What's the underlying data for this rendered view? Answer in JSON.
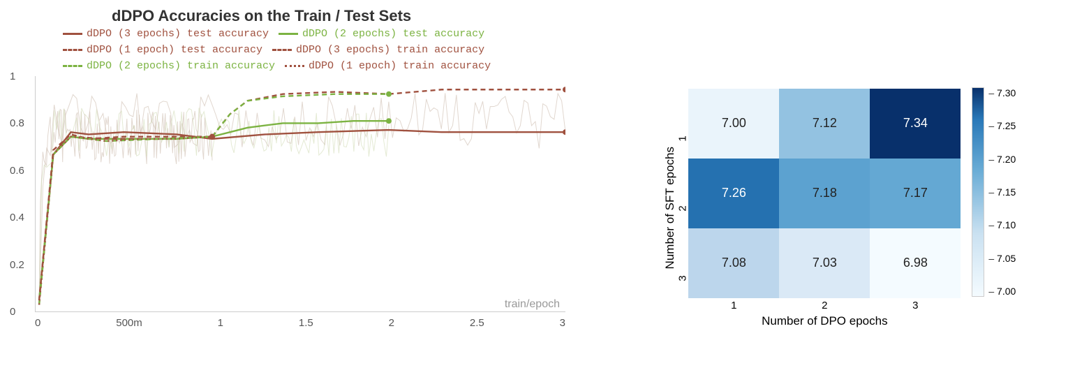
{
  "chart_data": [
    {
      "type": "line",
      "title": "dDPO Accuracies on the Train / Test Sets",
      "xlabel": "train/epoch",
      "x_ticks": [
        "0",
        "500m",
        "1",
        "1.5",
        "2",
        "2.5",
        "3"
      ],
      "y_ticks": [
        "0",
        "0.2",
        "0.4",
        "0.6",
        "0.8",
        "1"
      ],
      "xlim": [
        0,
        3
      ],
      "ylim": [
        0,
        1.05
      ],
      "series": [
        {
          "name": "dDPO (3 epochs) test accuracy",
          "color": "#a0513f",
          "style": "solid",
          "x": [
            0.02,
            0.1,
            0.2,
            0.3,
            0.5,
            0.8,
            1.0,
            1.3,
            1.6,
            2.0,
            2.3,
            2.6,
            3.0
          ],
          "y": [
            0.05,
            0.7,
            0.8,
            0.79,
            0.8,
            0.79,
            0.77,
            0.79,
            0.8,
            0.81,
            0.8,
            0.8,
            0.8
          ]
        },
        {
          "name": "dDPO (2 epochs) test accuracy",
          "color": "#7cb342",
          "style": "solid",
          "x": [
            0.02,
            0.1,
            0.2,
            0.3,
            0.5,
            0.8,
            1.0,
            1.2,
            1.4,
            1.6,
            1.8,
            2.0
          ],
          "y": [
            0.05,
            0.7,
            0.78,
            0.77,
            0.77,
            0.77,
            0.78,
            0.82,
            0.84,
            0.84,
            0.85,
            0.85
          ]
        },
        {
          "name": "dDPO (1 epoch) test accuracy",
          "color": "#a0513f",
          "style": "dashed",
          "x": [
            0.02,
            0.1,
            0.2,
            0.3,
            0.5,
            0.7,
            0.9,
            1.0
          ],
          "y": [
            0.05,
            0.72,
            0.79,
            0.77,
            0.78,
            0.78,
            0.78,
            0.78
          ]
        },
        {
          "name": "dDPO (3 epochs) train accuracy",
          "color": "#a0513f",
          "style": "dashed",
          "x": [
            0.02,
            0.1,
            0.2,
            0.4,
            0.7,
            1.0,
            1.1,
            1.2,
            1.4,
            1.7,
            2.0,
            2.3,
            2.6,
            3.0
          ],
          "y": [
            0.03,
            0.7,
            0.78,
            0.77,
            0.77,
            0.78,
            0.88,
            0.94,
            0.97,
            0.98,
            0.97,
            0.99,
            0.99,
            0.99
          ]
        },
        {
          "name": "dDPO (2 epochs) train accuracy",
          "color": "#7cb342",
          "style": "dashed",
          "x": [
            0.02,
            0.1,
            0.2,
            0.4,
            0.7,
            1.0,
            1.1,
            1.2,
            1.4,
            1.7,
            2.0
          ],
          "y": [
            0.03,
            0.7,
            0.78,
            0.76,
            0.77,
            0.78,
            0.88,
            0.94,
            0.96,
            0.97,
            0.97
          ]
        },
        {
          "name": "dDPO (1 epoch) train accuracy",
          "color": "#a0513f",
          "style": "dotted",
          "x": [
            0.02,
            0.1,
            0.2,
            0.4,
            0.6,
            0.8,
            1.0
          ],
          "y": [
            0.03,
            0.7,
            0.78,
            0.76,
            0.77,
            0.77,
            0.78
          ]
        }
      ],
      "legend_position": "top"
    },
    {
      "type": "heatmap",
      "xlabel": "Number of DPO epochs",
      "ylabel": "Number of SFT epochs",
      "x_categories": [
        "1",
        "2",
        "3"
      ],
      "y_categories": [
        "1",
        "2",
        "3"
      ],
      "values": [
        [
          7.0,
          7.12,
          7.34
        ],
        [
          7.26,
          7.18,
          7.17
        ],
        [
          7.08,
          7.03,
          6.98
        ]
      ],
      "colorbar_ticks": [
        "7.30",
        "7.25",
        "7.20",
        "7.15",
        "7.10",
        "7.05",
        "7.00"
      ],
      "colorbar_range": [
        6.98,
        7.34
      ],
      "colormap": "Blues"
    }
  ]
}
